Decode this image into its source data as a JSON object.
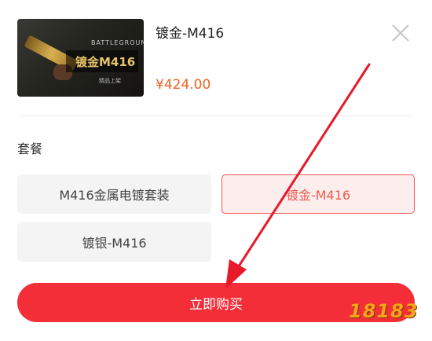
{
  "product": {
    "thumbnail": {
      "brand": "BATTLEGROUNDS",
      "skin_name": "镀金M416",
      "caption": "精品上架"
    },
    "title": "镀金-M416",
    "price": "¥424.00"
  },
  "package": {
    "label": "套餐",
    "options": [
      {
        "label": "M416金属电镀套装",
        "selected": false
      },
      {
        "label": "镀金-M416",
        "selected": true
      },
      {
        "label": "镀银-M416",
        "selected": false
      }
    ]
  },
  "buy_button": {
    "label": "立即购买"
  },
  "watermark": "18183",
  "colors": {
    "accent": "#f42e38",
    "price": "#f0601e",
    "selected_border": "#f05454",
    "arrow": "#e8192a"
  },
  "icons": {
    "close": "close-icon",
    "arrow": "annotation-arrow"
  }
}
